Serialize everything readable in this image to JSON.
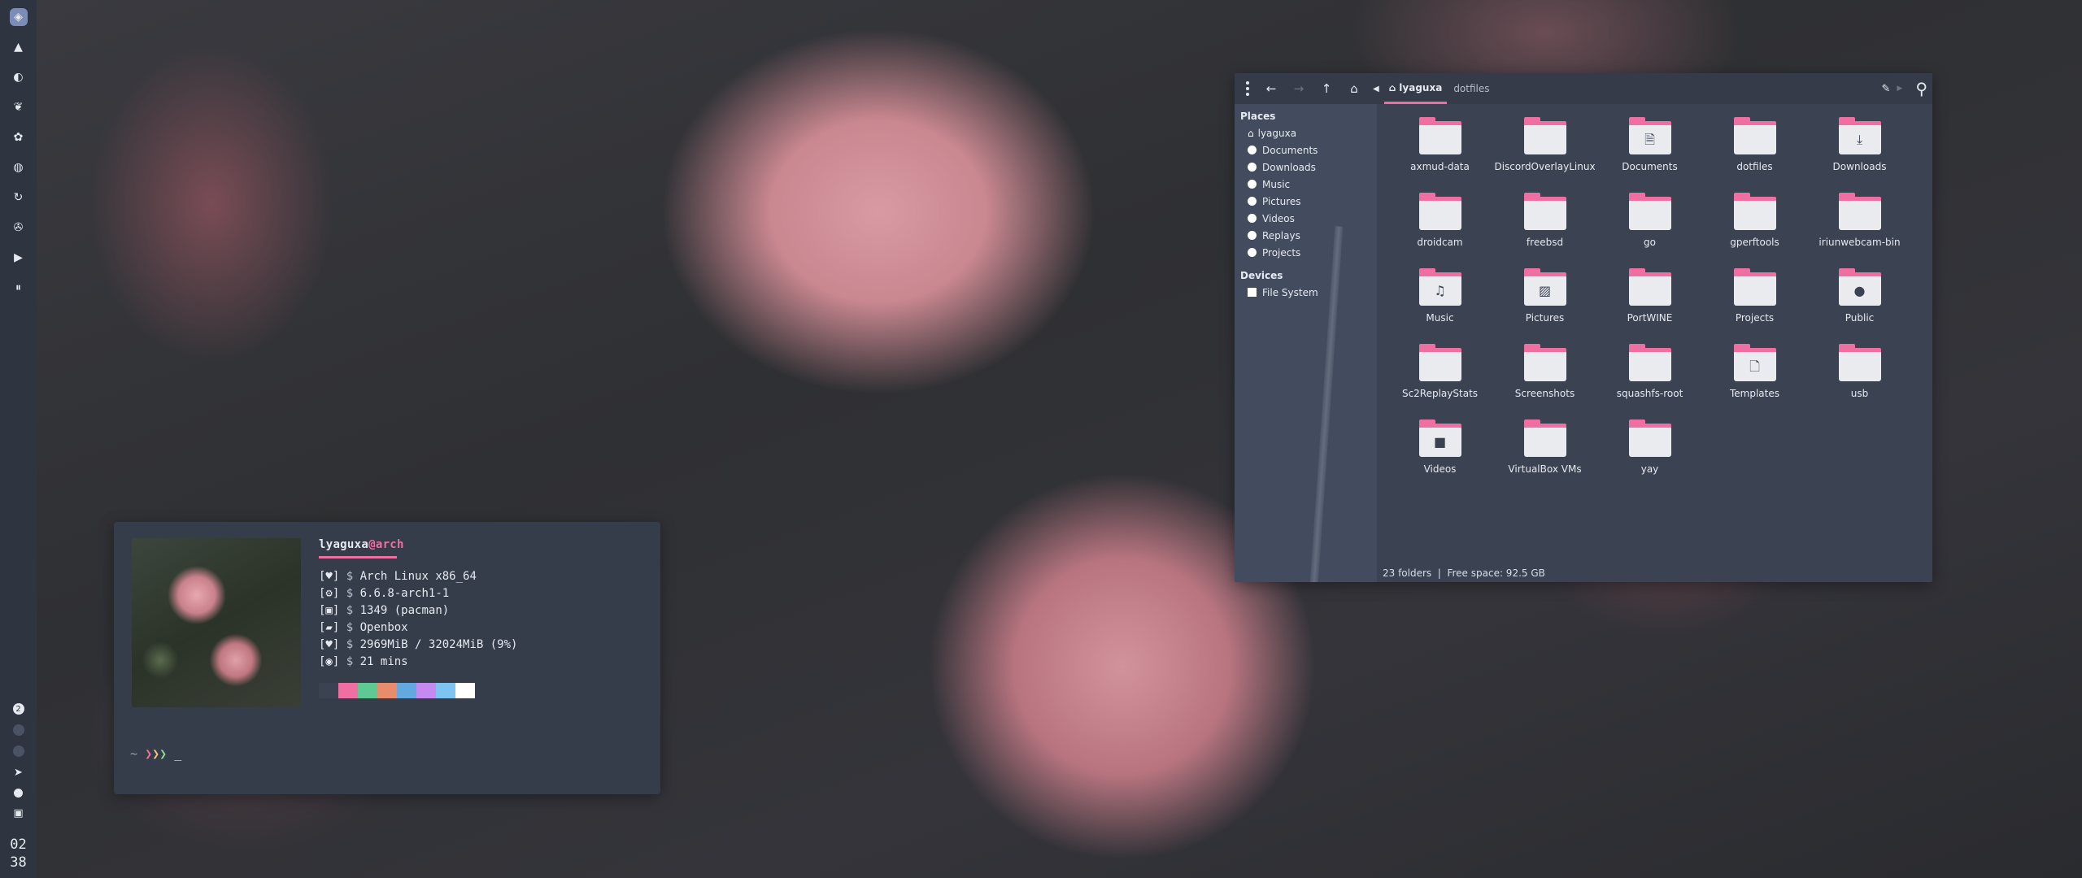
{
  "dock": {
    "icons": [
      "layers-icon",
      "mountain-icon",
      "toggle-icon",
      "leaf-icon",
      "flower-icon",
      "palette-icon",
      "refresh-icon",
      "aperture-icon",
      "play-icon",
      "equalizer-icon"
    ],
    "bottom_badge": "2",
    "clock_hour": "02",
    "clock_minute": "38"
  },
  "terminal": {
    "user": "lyaguxa",
    "at": "@",
    "host": "arch",
    "lines": [
      {
        "icon": "[♥]",
        "prompt": "$",
        "value": "Arch Linux x86_64"
      },
      {
        "icon": "[⚙]",
        "prompt": "$",
        "value": "6.6.8-arch1-1"
      },
      {
        "icon": "[▣]",
        "prompt": "$",
        "value": "1349 (pacman)"
      },
      {
        "icon": "[▰]",
        "prompt": "$",
        "value": "Openbox"
      },
      {
        "icon": "[♥]",
        "prompt": "$",
        "value": "2969MiB / 32024MiB (9%)"
      },
      {
        "icon": "[◉]",
        "prompt": "$",
        "value": "21 mins"
      }
    ],
    "swatches": [
      "#3b4252",
      "#f06fa3",
      "#5fc993",
      "#e98c6b",
      "#63a9e0",
      "#c58af0",
      "#7fc4f0",
      "#ffffff"
    ],
    "prompt_tilde": "~",
    "prompt_arrows": [
      "❯",
      "❯",
      "❯"
    ],
    "cursor": "_"
  },
  "file_manager": {
    "breadcrumb": [
      "lyaguxa",
      "dotfiles"
    ],
    "places_heading": "Places",
    "places": [
      "lyaguxa",
      "Documents",
      "Downloads",
      "Music",
      "Pictures",
      "Videos",
      "Replays",
      "Projects"
    ],
    "devices_heading": "Devices",
    "devices": [
      "File System"
    ],
    "items": [
      {
        "name": "axmud-data",
        "icon": "folder-icon"
      },
      {
        "name": "DiscordOverlayLinux",
        "icon": "folder-icon"
      },
      {
        "name": "Documents",
        "icon": "folder-documents-icon"
      },
      {
        "name": "dotfiles",
        "icon": "folder-icon"
      },
      {
        "name": "Downloads",
        "icon": "folder-download-icon"
      },
      {
        "name": "droidcam",
        "icon": "folder-icon"
      },
      {
        "name": "freebsd",
        "icon": "folder-icon"
      },
      {
        "name": "go",
        "icon": "folder-icon"
      },
      {
        "name": "gperftools",
        "icon": "folder-icon"
      },
      {
        "name": "iriunwebcam-bin",
        "icon": "folder-icon"
      },
      {
        "name": "Music",
        "icon": "folder-music-icon"
      },
      {
        "name": "Pictures",
        "icon": "folder-pictures-icon"
      },
      {
        "name": "PortWINE",
        "icon": "folder-icon"
      },
      {
        "name": "Projects",
        "icon": "folder-icon"
      },
      {
        "name": "Public",
        "icon": "folder-public-icon"
      },
      {
        "name": "Sc2ReplayStats",
        "icon": "folder-icon"
      },
      {
        "name": "Screenshots",
        "icon": "folder-icon"
      },
      {
        "name": "squashfs-root",
        "icon": "folder-icon"
      },
      {
        "name": "Templates",
        "icon": "folder-templates-icon"
      },
      {
        "name": "usb",
        "icon": "folder-icon"
      },
      {
        "name": "Videos",
        "icon": "folder-videos-icon"
      },
      {
        "name": "VirtualBox VMs",
        "icon": "folder-icon"
      },
      {
        "name": "yay",
        "icon": "folder-icon"
      }
    ],
    "status": "23 folders  |  Free space: 92.5 GB"
  }
}
